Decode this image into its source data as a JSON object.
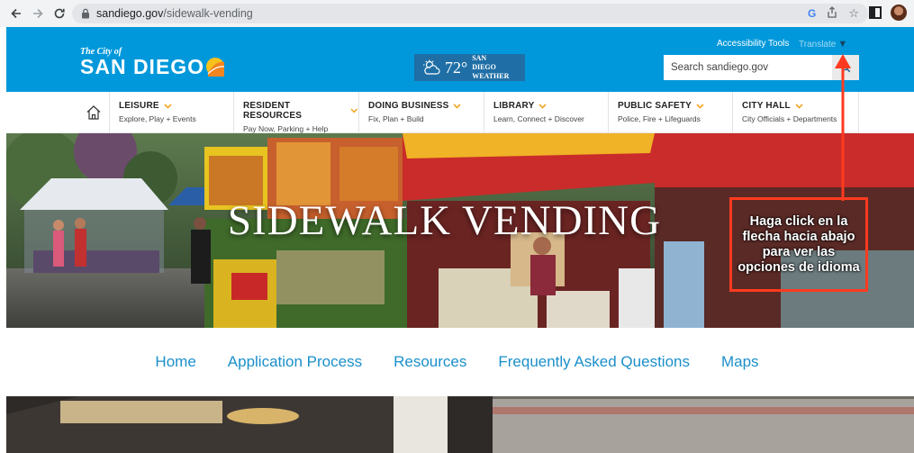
{
  "browser": {
    "url_host": "sandiego.gov",
    "url_path": "/sidewalk-vending"
  },
  "header": {
    "logo_small": "The City of",
    "logo_big": "SAN DIEGO",
    "weather_temp": "72°",
    "weather_label": "SAN DIEGO WEATHER",
    "accessibility_label": "Accessibility Tools",
    "translate_label": "Translate",
    "translate_caret": "▼",
    "search_placeholder": "Search sandiego.gov"
  },
  "main_nav": {
    "items": [
      {
        "title": "LEISURE",
        "sub": "Explore, Play + Events"
      },
      {
        "title": "RESIDENT RESOURCES",
        "sub": "Pay Now, Parking + Help"
      },
      {
        "title": "DOING BUSINESS",
        "sub": "Fix, Plan + Build"
      },
      {
        "title": "LIBRARY",
        "sub": "Learn, Connect + Discover"
      },
      {
        "title": "PUBLIC SAFETY",
        "sub": "Police, Fire + Lifeguards"
      },
      {
        "title": "CITY HALL",
        "sub": "City Officials + Departments"
      }
    ]
  },
  "hero": {
    "title": "SIDEWALK VENDING"
  },
  "annotation": {
    "text": "Haga click en la flecha hacia abajo para ver las opciones de idioma"
  },
  "sub_nav": {
    "items": [
      "Home",
      "Application Process",
      "Resources",
      "Frequently Asked Questions",
      "Maps"
    ]
  },
  "colors": {
    "header_blue": "#0098db",
    "link_blue": "#1b8fca",
    "chevron_orange": "#f5a623",
    "annotation_red": "#ff3b1f"
  }
}
